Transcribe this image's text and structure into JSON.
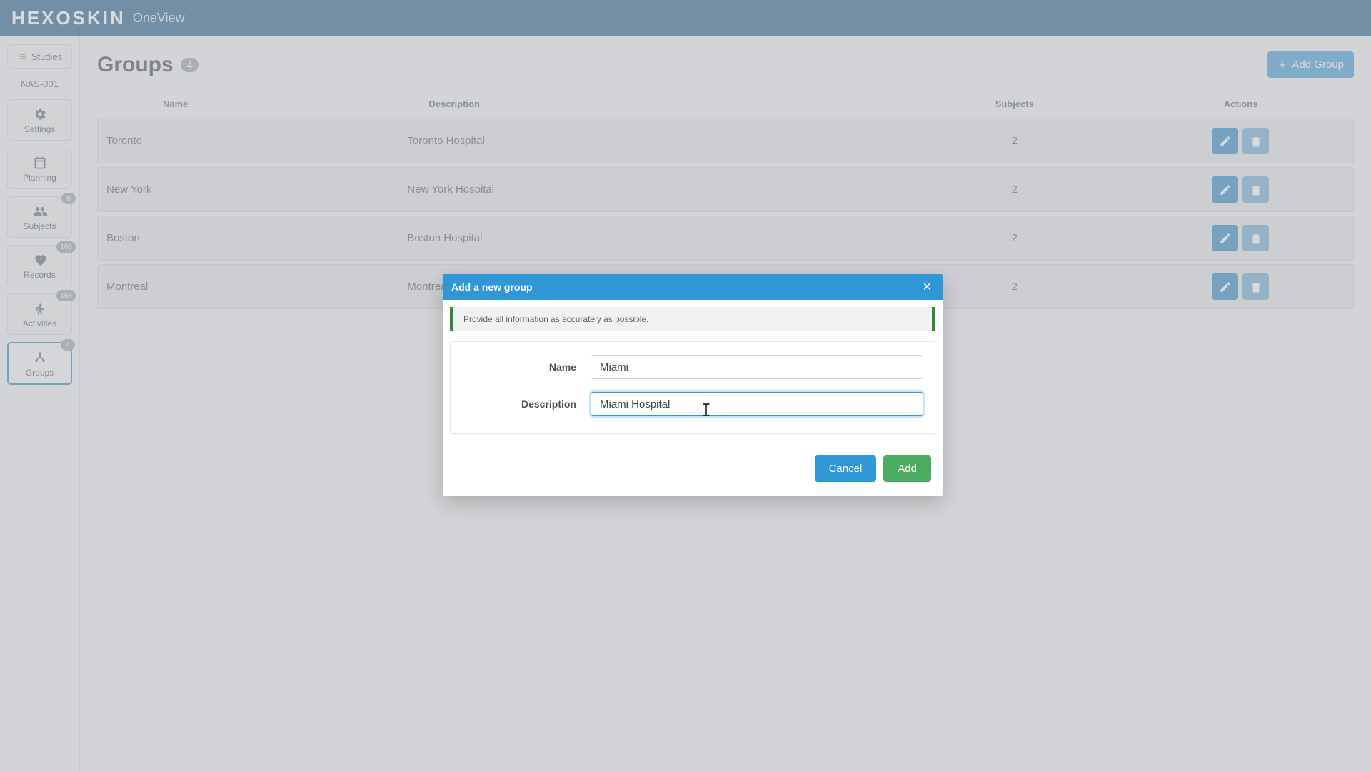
{
  "brand": {
    "logo": "HEXOSKIN",
    "sub": "OneView"
  },
  "sidebar": {
    "studies_label": "Studies",
    "study_id": "NAS-001",
    "items": [
      {
        "label": "Settings",
        "badge": ""
      },
      {
        "label": "Planning",
        "badge": ""
      },
      {
        "label": "Subjects",
        "badge": "8"
      },
      {
        "label": "Records",
        "badge": "168"
      },
      {
        "label": "Activities",
        "badge": "168"
      },
      {
        "label": "Groups",
        "badge": "4"
      }
    ]
  },
  "page": {
    "title": "Groups",
    "count": "4",
    "add_button": "Add Group",
    "columns": {
      "name": "Name",
      "description": "Description",
      "subjects": "Subjects",
      "actions": "Actions"
    },
    "rows": [
      {
        "name": "Toronto",
        "description": "Toronto Hospital",
        "subjects": "2"
      },
      {
        "name": "New York",
        "description": "New York Hospital",
        "subjects": "2"
      },
      {
        "name": "Boston",
        "description": "Boston Hospital",
        "subjects": "2"
      },
      {
        "name": "Montreal",
        "description": "Montreal Hospital",
        "subjects": "2"
      }
    ]
  },
  "modal": {
    "title": "Add a new group",
    "banner": "Provide all information as accurately as possible.",
    "name_label": "Name",
    "description_label": "Description",
    "name_value": "Miami",
    "description_value": "Miami Hospital",
    "cancel": "Cancel",
    "add": "Add"
  },
  "colors": {
    "primary": "#2f97d6",
    "header": "#1b5a88",
    "success": "#4bab62"
  }
}
